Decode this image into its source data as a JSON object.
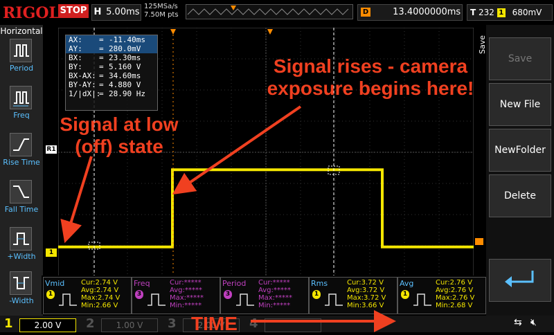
{
  "topbar": {
    "brand": "RIGOL",
    "run_state": "STOP",
    "h_label": "H",
    "timebase": "5.00ms",
    "sample_rate": "125MSa/s",
    "memory_points": "7.50M pts",
    "d_label": "D",
    "delay": "13.4000000ms",
    "t_label": "T",
    "trigger_level_code": "232",
    "trigger_channel": "1",
    "trigger_level": "680mV"
  },
  "left_menu": {
    "title": "Horizontal",
    "items": [
      {
        "label": "Period",
        "icon": "period-icon"
      },
      {
        "label": "Freq",
        "icon": "freq-icon"
      },
      {
        "label": "Rise Time",
        "icon": "rise-time-icon"
      },
      {
        "label": "Fall Time",
        "icon": "fall-time-icon"
      },
      {
        "label": "+Width",
        "icon": "pos-width-icon"
      },
      {
        "label": "-Width",
        "icon": "neg-width-icon"
      }
    ]
  },
  "right_menu": {
    "title": "Save",
    "buttons": [
      {
        "label": "Save",
        "enabled": false
      },
      {
        "label": "New File",
        "enabled": true
      },
      {
        "label": "NewFolder",
        "enabled": true
      },
      {
        "label": "Delete",
        "enabled": true
      }
    ],
    "back_icon": "return-arrow-icon"
  },
  "cursor_panel": {
    "rows": [
      {
        "label": "AX:",
        "value": "-11.40ms",
        "highlight": true
      },
      {
        "label": "AY:",
        "value": "280.0mV",
        "highlight": true
      },
      {
        "label": "BX:",
        "value": "23.30ms",
        "highlight": false
      },
      {
        "label": "BY:",
        "value": "5.160 V",
        "highlight": false
      },
      {
        "label": "BX-AX:",
        "value": "34.60ms",
        "highlight": false
      },
      {
        "label": "BY-AY:",
        "value": "4.880 V",
        "highlight": false
      },
      {
        "label": "1/|dX|:",
        "value": "28.90 Hz",
        "highlight": false
      }
    ]
  },
  "markers": {
    "channel1": "1",
    "reference": "R1"
  },
  "waveform": {
    "color": "#f4e600",
    "low_level_fraction": 0.88,
    "high_level_fraction": 0.57,
    "rise_at_fraction": 0.275,
    "fall_at_fraction": 0.78
  },
  "measurements": [
    {
      "name": "Vmid",
      "ch": "1",
      "rows": [
        "Cur:2.74 V",
        "Avg:2.74 V",
        "Max:2.74 V",
        "Min:2.66 V"
      ],
      "active": true
    },
    {
      "name": "Freq",
      "ch": "3",
      "rows": [
        "Cur:*****",
        "Avg:*****",
        "Max:*****",
        "Min:*****"
      ],
      "active": false
    },
    {
      "name": "Period",
      "ch": "3",
      "rows": [
        "Cur:*****",
        "Avg:*****",
        "Max:*****",
        "Min:*****"
      ],
      "active": false
    },
    {
      "name": "Rms",
      "ch": "1",
      "rows": [
        "Cur:3.72 V",
        "Avg:3.72 V",
        "Max:3.72 V",
        "Min:3.66 V"
      ],
      "active": true
    },
    {
      "name": "Avg",
      "ch": "1",
      "rows": [
        "Cur:2.76 V",
        "Avg:2.76 V",
        "Max:2.76 V",
        "Min:2.68 V"
      ],
      "active": true
    }
  ],
  "bottombar": {
    "channels": [
      {
        "num": "1",
        "scale": "2.00 V",
        "color": "#f4e600"
      },
      {
        "num": "2",
        "scale": "1.00 V",
        "color": "#555555"
      },
      {
        "num": "3",
        "scale": "2.00 V",
        "color": "#555555"
      },
      {
        "num": "4",
        "scale": "",
        "color": "#555555"
      }
    ]
  },
  "annotations": {
    "signal_low": "Signal at low\n(off) state",
    "signal_rises": "Signal rises - camera\nexposure begins here!",
    "time": "TIME"
  },
  "colors": {
    "ch1": "#f4e600",
    "menu_label": "#5bc0ff",
    "annotation": "#f04020",
    "stop": "#d02020"
  }
}
